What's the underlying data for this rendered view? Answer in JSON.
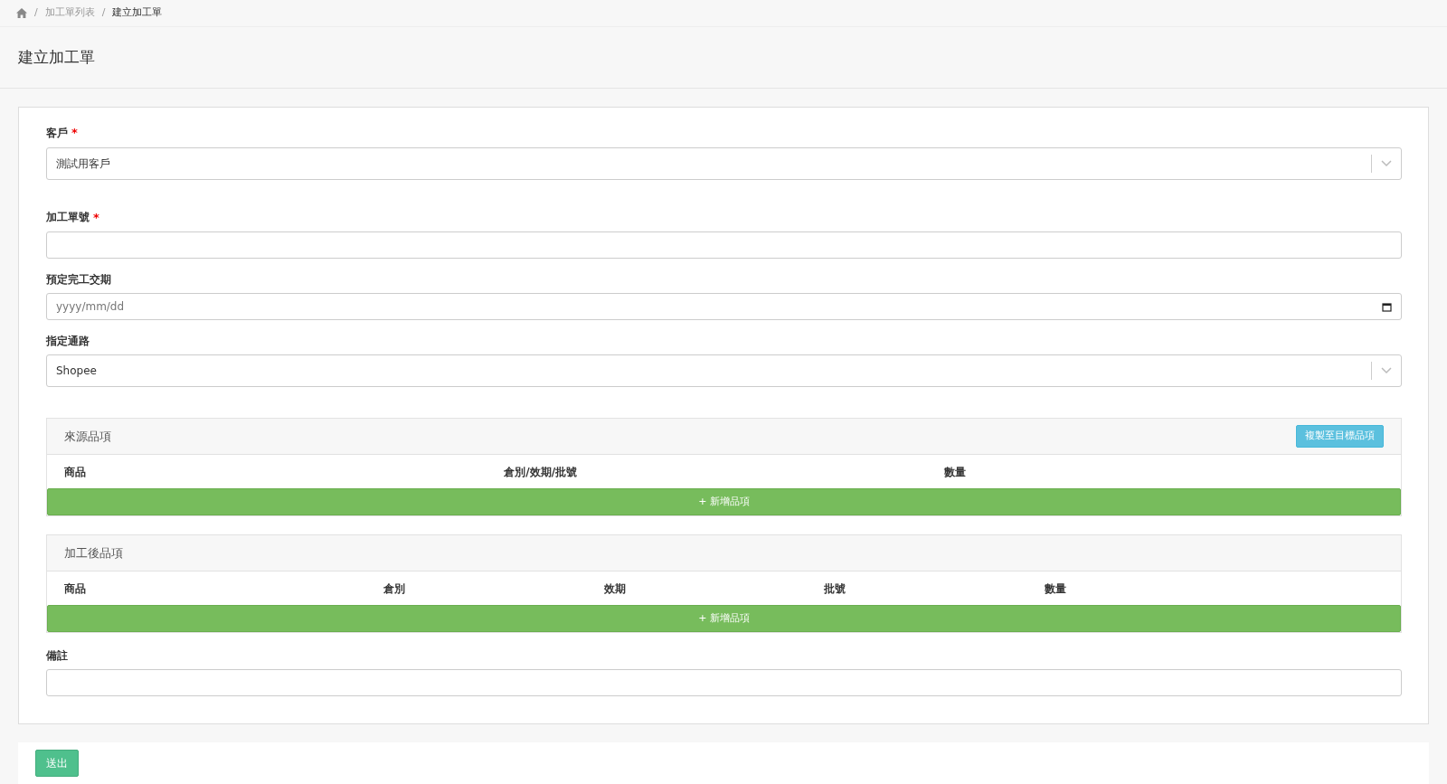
{
  "breadcrumb": [
    {
      "separator": "/",
      "label": "加工單列表",
      "selected": false
    },
    {
      "separator": "/",
      "label": "建立加工單",
      "selected": true
    }
  ],
  "page_title": "建立加工單",
  "fields": [
    {
      "kind": "select",
      "label": "客戶",
      "required_mark": "*",
      "value": "測試用客戶"
    },
    {
      "kind": "text",
      "label": "加工單號",
      "required_mark": "*"
    },
    {
      "kind": "date",
      "label": "預定完工交期",
      "placeholder": "yyyy/mm/dd"
    },
    {
      "kind": "select",
      "label": "指定通路",
      "value": "Shopee"
    }
  ],
  "panels": [
    {
      "title": "來源品項",
      "action": "複製至目標品項",
      "columns": [
        "商品",
        "倉別/效期/批號",
        "數量"
      ],
      "add_button": "+ 新增品項"
    },
    {
      "title": "加工後品項",
      "columns": [
        "商品",
        "倉別",
        "效期",
        "批號",
        "數量"
      ],
      "add_button": "+ 新增品項"
    }
  ],
  "note": {
    "label": "備註"
  },
  "submit": "送出"
}
